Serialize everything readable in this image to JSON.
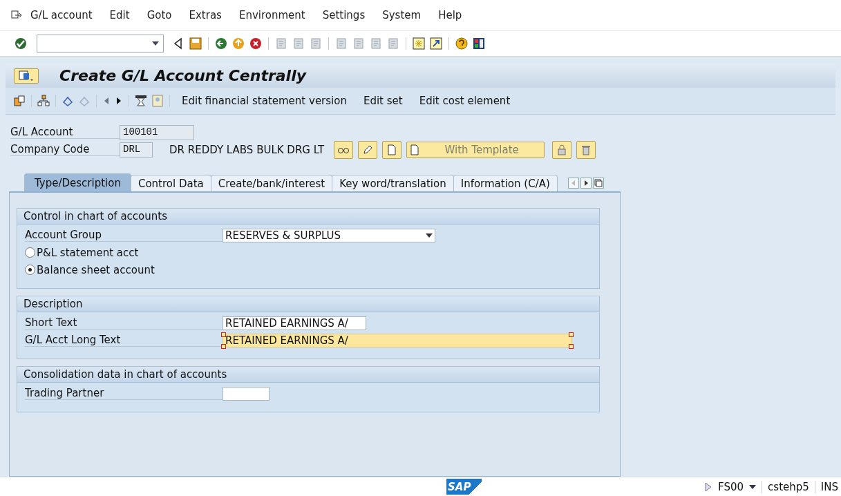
{
  "menu_bar": {
    "items": [
      "G/L account",
      "Edit",
      "Goto",
      "Extras",
      "Environment",
      "Settings",
      "System",
      "Help"
    ]
  },
  "title": "Create G/L Account Centrally",
  "app_toolbar": {
    "buttons": [
      "Edit financial statement version",
      "Edit set",
      "Edit cost element"
    ]
  },
  "header_fields": [
    {
      "label": "G/L Account",
      "value": "100101"
    },
    {
      "label": "Company Code",
      "value": "DRL",
      "description": "DR REDDY LABS BULK DRG LT"
    }
  ],
  "template_button": "With Template",
  "tabs": [
    {
      "label": "Type/Description",
      "selected": true
    },
    {
      "label": "Control Data",
      "selected": false
    },
    {
      "label": "Create/bank/interest",
      "selected": false
    },
    {
      "label": "Key word/translation",
      "selected": false
    },
    {
      "label": "Information (C/A)",
      "selected": false
    }
  ],
  "groups": [
    {
      "title": "Control in chart of accounts",
      "rows": [
        {
          "kind": "dropdown",
          "label": "Account Group",
          "value": "RESERVES & SURPLUS"
        },
        {
          "kind": "radio",
          "label": "P&L statement acct",
          "selected": false
        },
        {
          "kind": "radio",
          "label": "Balance sheet account",
          "selected": true
        }
      ]
    },
    {
      "title": "Description",
      "rows": [
        {
          "kind": "input",
          "label": "Short Text",
          "value": "RETAINED EARNINGS A/",
          "focused": false
        },
        {
          "kind": "input_long",
          "label": "G/L Acct Long Text",
          "value": "RETAINED EARNINGS A/",
          "focused": true
        }
      ]
    },
    {
      "title": "Consolidation data in chart of accounts",
      "rows": [
        {
          "kind": "input_small",
          "label": "Trading Partner",
          "value": "",
          "focused": false
        }
      ]
    }
  ],
  "status_bar": {
    "logo": "SAP",
    "transaction": "FS00",
    "server": "cstehp5",
    "mode": "INS"
  }
}
